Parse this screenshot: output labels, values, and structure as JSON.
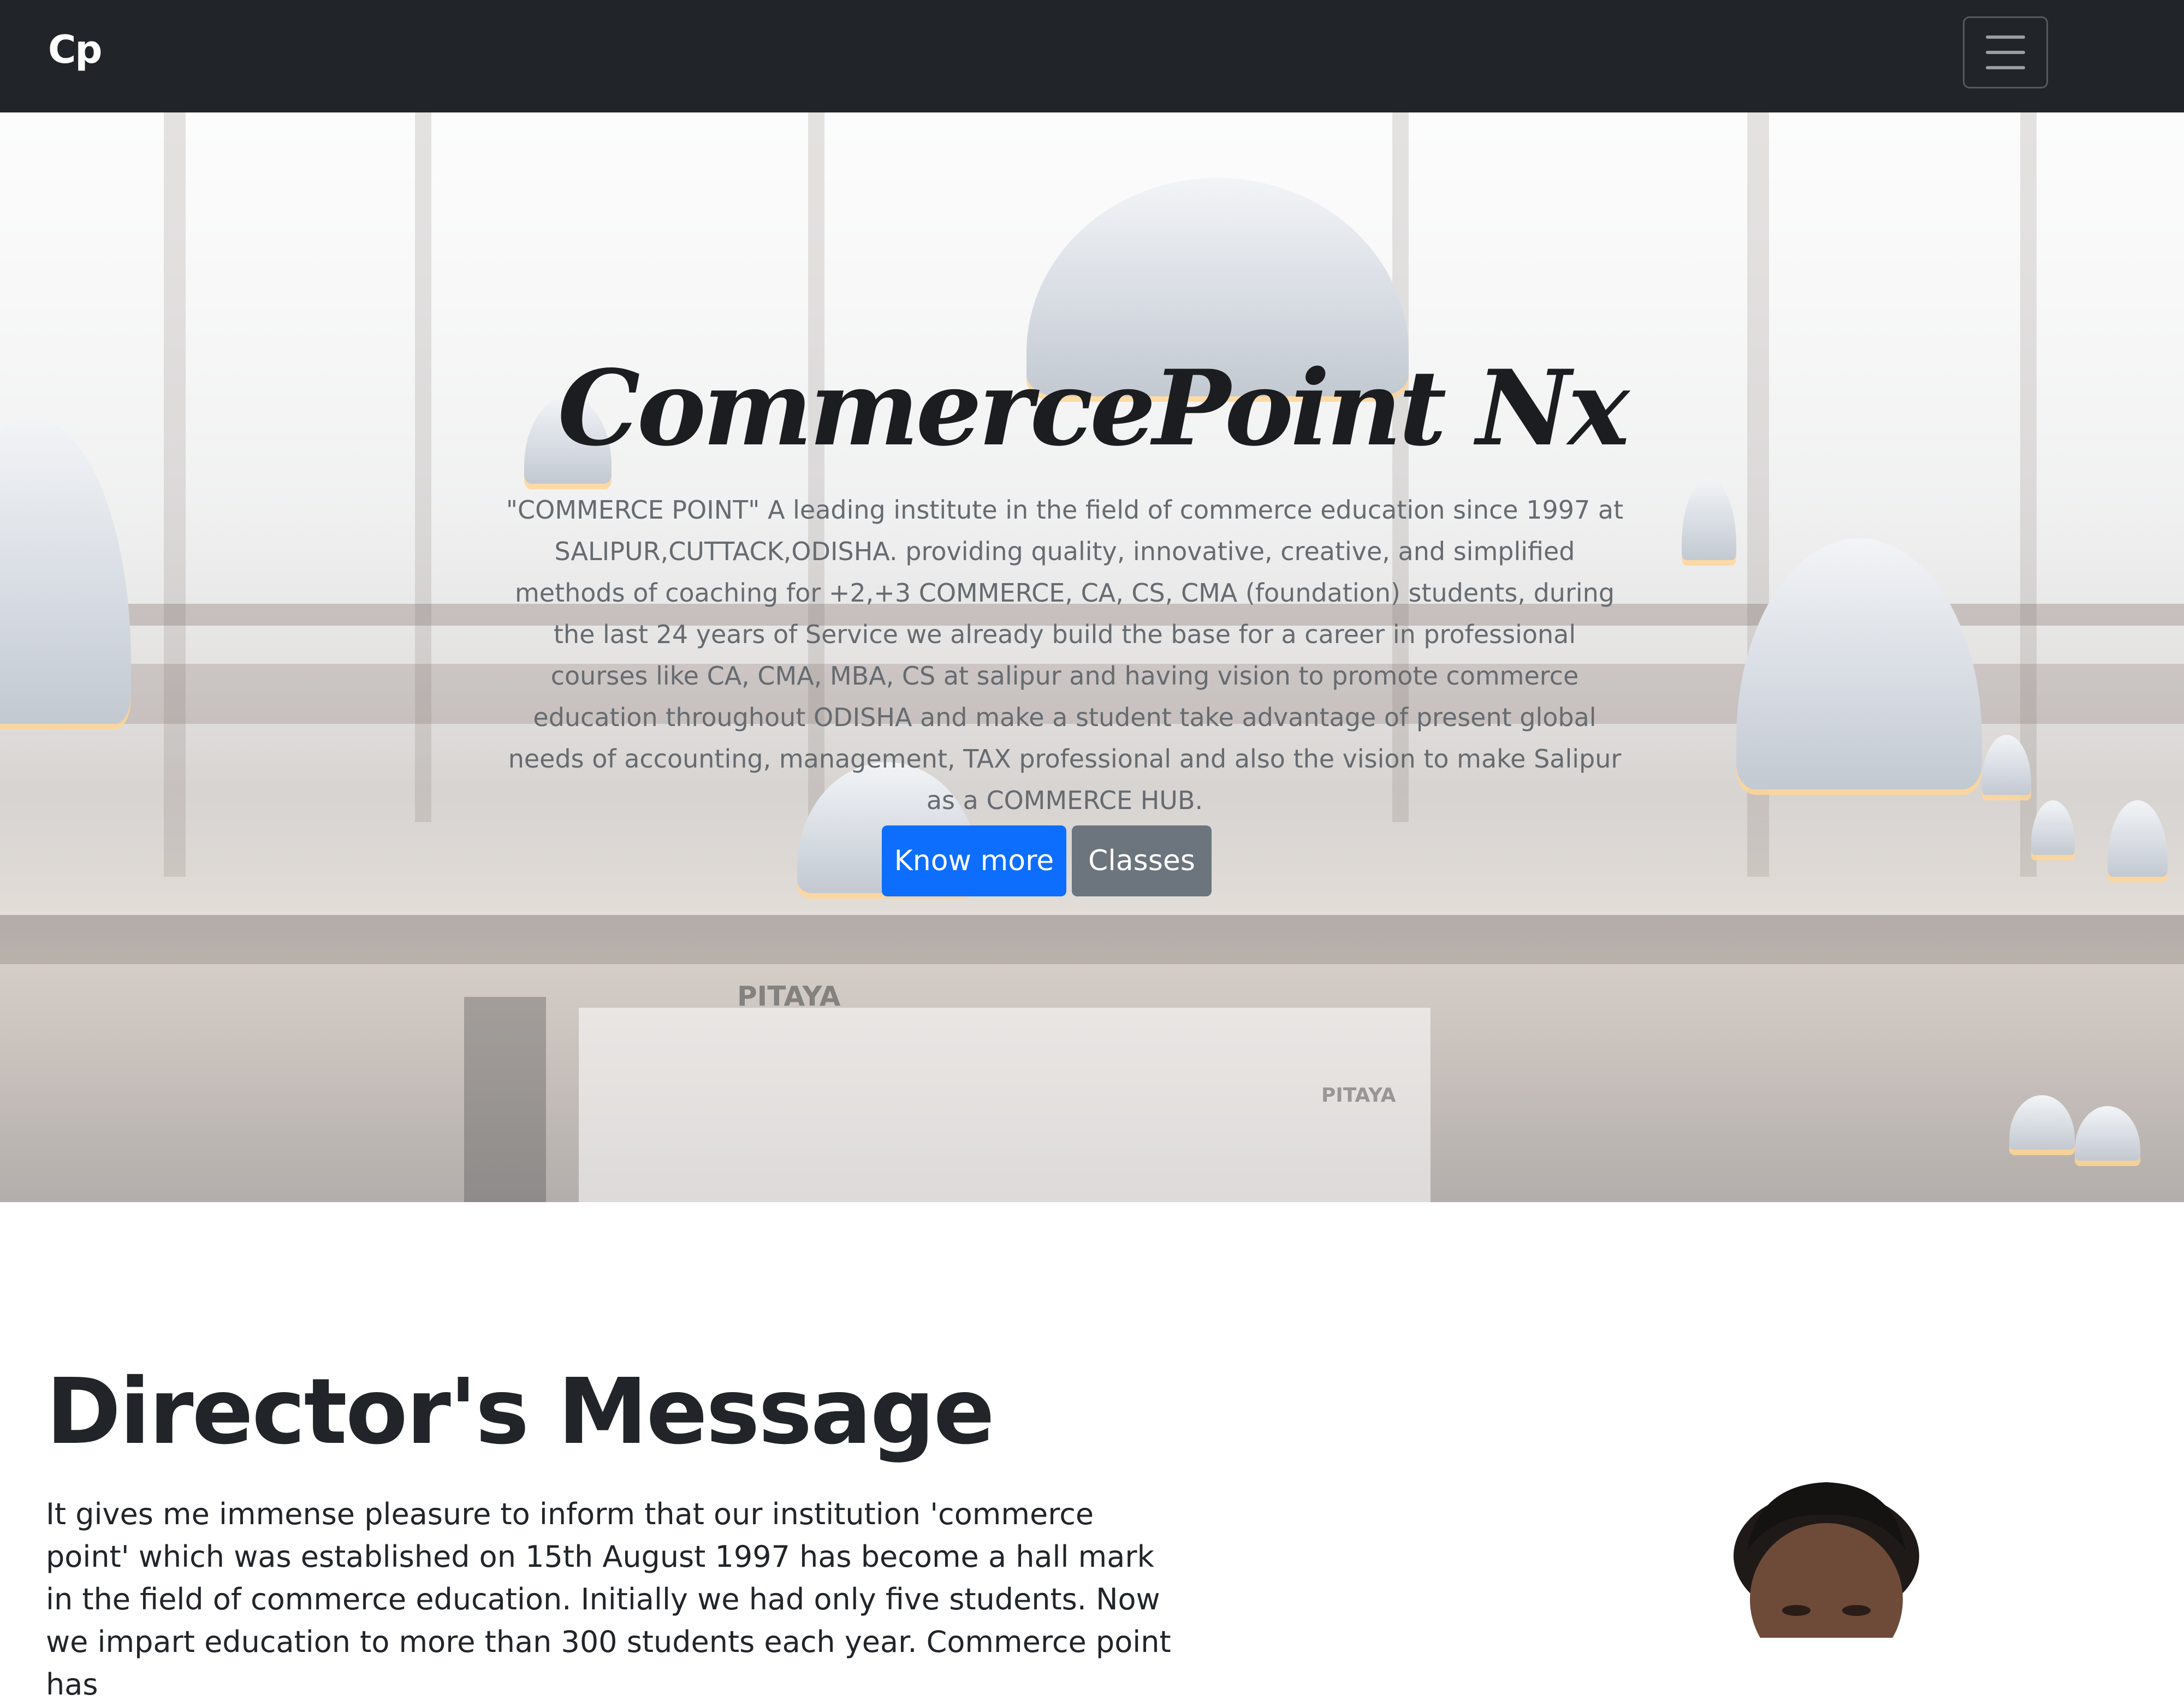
{
  "navbar": {
    "brand": "Cp",
    "toggler_icon": "hamburger-icon"
  },
  "hero": {
    "title": "CommercePoint Nx",
    "description": "\"COMMERCE POINT\" A leading institute in the field of commerce education since 1997 at SALIPUR,CUTTACK,ODISHA. providing quality, innovative, creative, and simplified methods of coaching for +2,+3 COMMERCE, CA, CS, CMA (foundation) students, during the last 24 years of Service we already build the base for a career in professional courses like CA, CMA, MBA, CS at salipur and having vision to promote commerce education throughout ODISHA and make a student take advantage of present global needs of accounting, management, TAX professional and also the vision to make Salipur as a COMMERCE HUB.",
    "buttons": {
      "know_more": "Know more",
      "classes": "Classes"
    },
    "background_signs": [
      "PITAYA",
      "PITAYA"
    ]
  },
  "director": {
    "title": "Director's Message",
    "text": "It gives me immense pleasure to inform that our institution 'commerce point' which was established on 15th August 1997 has become a hall mark in the field of commerce education. Initially we had only five students. Now we impart education to more than 300 students each year. Commerce point has"
  },
  "colors": {
    "navbar_bg": "#212529",
    "primary": "#0d6efd",
    "secondary": "#6c757d",
    "text_dark": "#212529",
    "hero_text": "#666b70"
  }
}
